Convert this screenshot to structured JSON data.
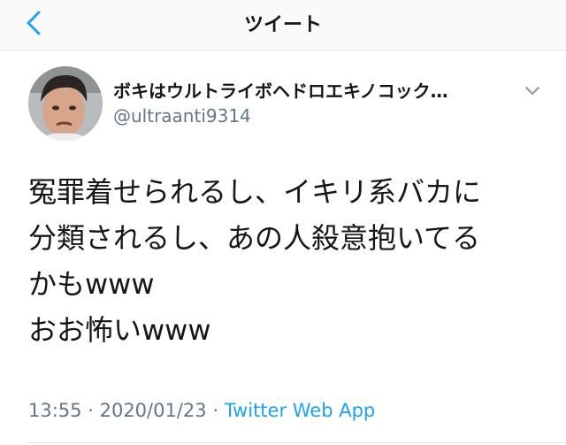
{
  "navbar": {
    "title": "ツイート",
    "back_icon": "chevron-left-icon"
  },
  "tweet": {
    "display_name": "ボキはウルトライボヘドロエキノコック…",
    "handle": "@ultraanti9314",
    "menu_icon": "chevron-down-icon",
    "text_lines": [
      "冤罪着せられるし、イキリ系バカに",
      "分類されるし、あの人殺意抱いてる",
      "かもwww",
      "おお怖いwww"
    ],
    "time": "13:55",
    "date": "2020/01/23",
    "separator": "·",
    "source": "Twitter Web App"
  },
  "colors": {
    "accent": "#1da1f2",
    "secondary_text": "#657786",
    "divider": "#e1e8ed"
  }
}
